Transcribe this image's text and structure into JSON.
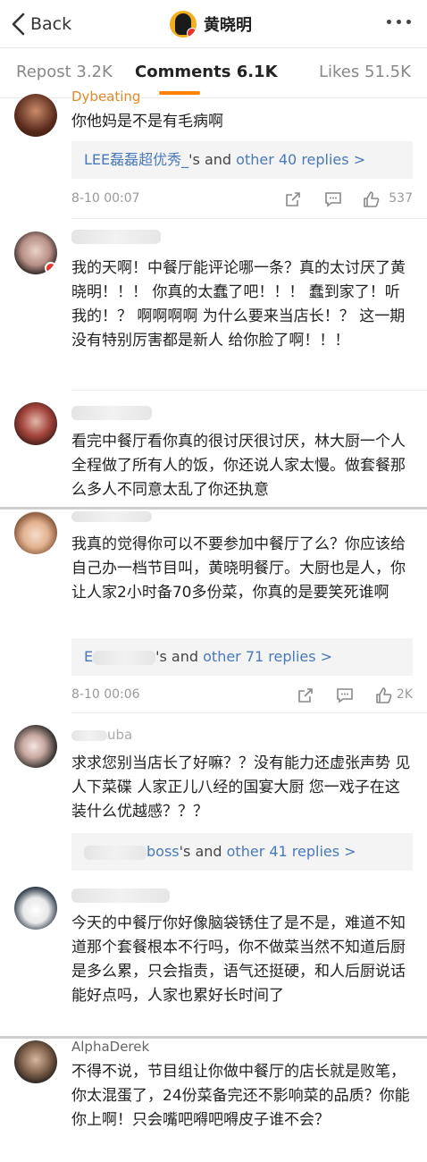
{
  "nav": {
    "back_label": "Back",
    "title": "黄晓明"
  },
  "tabs": [
    {
      "label": "Repost 3.2K"
    },
    {
      "label": "Comments 6.1K"
    },
    {
      "label": "Likes 51.5K"
    }
  ],
  "accent_color": "#ff8200",
  "link_color": "#4979b8",
  "comments": [
    {
      "username": "Dybeating",
      "text": "你他妈是不是有毛病啊",
      "replies_prefix": "LEE磊磊超优秀_",
      "replies_suffix": "'s and ",
      "replies_link": "other 40 replies >",
      "time": "8-10 00:07",
      "likes": "537"
    },
    {
      "username": "",
      "text": "我的天啊！中餐厅能评论哪一条？真的太讨厌了黄晓明！！！ 你真的太蠢了吧！！！ 蠢到家了！听我的！？ 啊啊啊啊 为什么要来当店长！？ 这一期没有特别厉害都是新人 给你脸了啊！！！"
    },
    {
      "username": "",
      "text": "看完中餐厅看你真的很讨厌很讨厌，林大厨一个人全程做了所有人的饭，你还说人家太慢。做套餐那么多人不同意太乱了你还执意"
    },
    {
      "username": "",
      "text": "我真的觉得你可以不要参加中餐厅了么？你应该给自己办一档节目叫，黄晓明餐厅。大厨也是人，你让人家2小时备70多份菜，你真的是要笑死谁啊",
      "replies_prefix": "E",
      "replies_suffix": "'s and ",
      "replies_link": "other 71 replies >",
      "time": "8-10 00:06",
      "likes": "2K"
    },
    {
      "username": "uba",
      "text": "求求您别当店长了好嘛？？没有能力还虚张声势 见人下菜碟 人家正儿八经的国宴大厨 您一戏子在这装什么优越感？？？",
      "replies_prefix": "boss",
      "replies_suffix": "'s and ",
      "replies_link": "other 41 replies >"
    },
    {
      "username": "",
      "text": "今天的中餐厅你好像脑袋锈住了是不是，难道不知道那个套餐根本不行吗，你不做菜当然不知道后厨是多么累，只会指责，语气还挺硬，和人后厨说话能好点吗，人家也累好长时间了"
    },
    {
      "username": "AlphaDerek",
      "text": "不得不说，节目组让你做中餐厅的店长就是败笔，你太混蛋了，24份菜备完还不影响菜的品质？你能你上啊！只会嘴吧嘚吧嘚皮子谁不会？"
    }
  ]
}
